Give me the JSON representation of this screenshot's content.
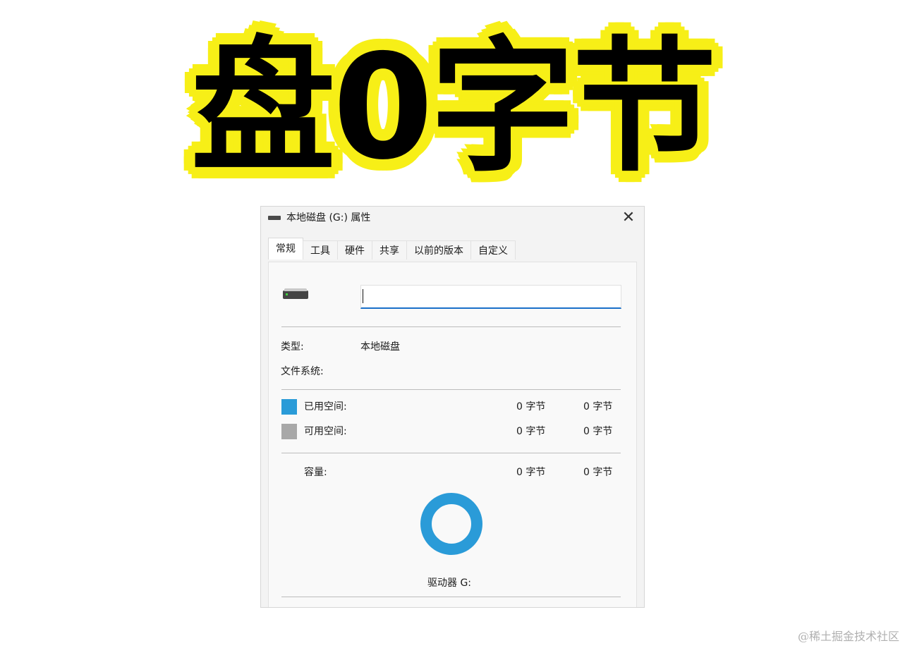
{
  "headline": "盘0字节",
  "colors": {
    "headline_fill": "#000000",
    "headline_outline": "#f7ef17",
    "used_space": "#2a9bd8",
    "free_space": "#a8a8a8",
    "input_focus": "#1a6fc9"
  },
  "dialog": {
    "title": "本地磁盘 (G:) 属性",
    "close_icon": "close-icon",
    "tabs": [
      {
        "label": "常规",
        "active": true
      },
      {
        "label": "工具"
      },
      {
        "label": "硬件"
      },
      {
        "label": "共享"
      },
      {
        "label": "以前的版本"
      },
      {
        "label": "自定义"
      }
    ],
    "name_input_value": "",
    "type_label": "类型:",
    "type_value": "本地磁盘",
    "filesystem_label": "文件系统:",
    "filesystem_value": "",
    "used": {
      "label": "已用空间:",
      "bytes": "0 字节",
      "size": "0 字节"
    },
    "free": {
      "label": "可用空间:",
      "bytes": "0 字节",
      "size": "0 字节"
    },
    "capacity": {
      "label": "容量:",
      "bytes": "0 字节",
      "size": "0 字节"
    },
    "drive_label": "驱动器 G:",
    "used_fraction": 1.0
  },
  "watermark": "@稀土掘金技术社区"
}
